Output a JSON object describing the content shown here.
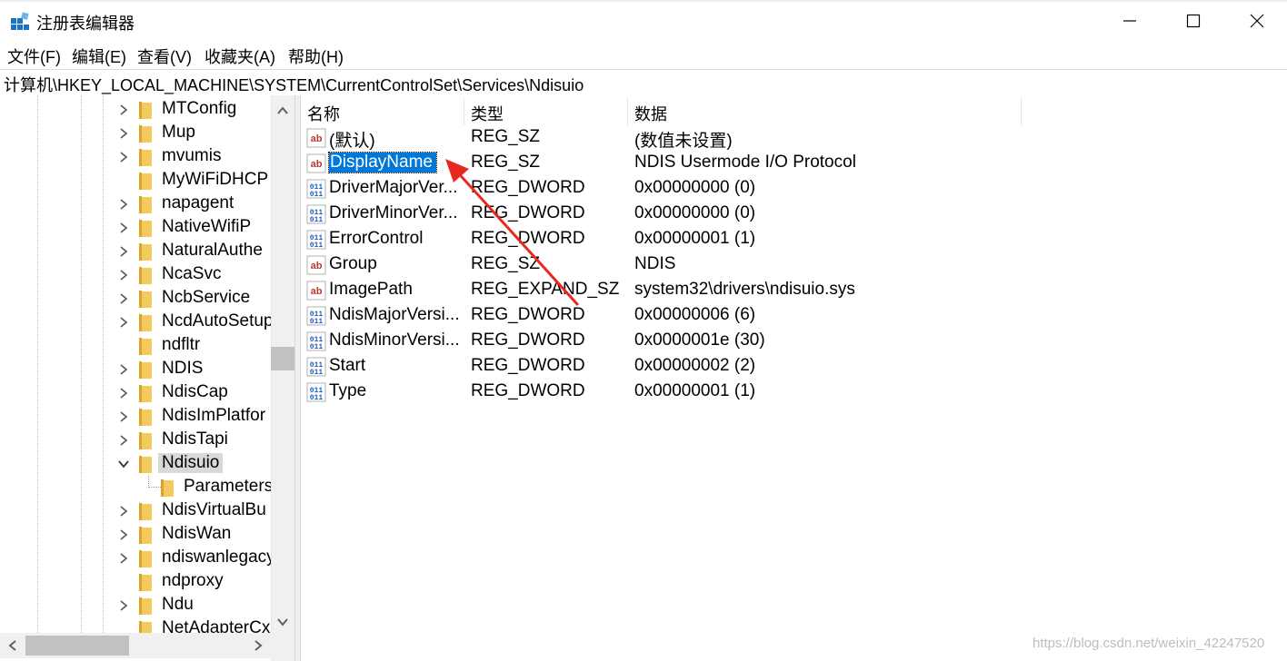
{
  "window": {
    "title": "注册表编辑器",
    "minimize_glyph": "—",
    "maximize_glyph": "☐",
    "close_glyph": "✕"
  },
  "menu": [
    {
      "label": "文件(F)"
    },
    {
      "label": "编辑(E)"
    },
    {
      "label": "查看(V)"
    },
    {
      "label": "收藏夹(A)"
    },
    {
      "label": "帮助(H)"
    }
  ],
  "address": "计算机\\HKEY_LOCAL_MACHINE\\SYSTEM\\CurrentControlSet\\Services\\Ndisuio",
  "tree": {
    "items": [
      {
        "label": "MTConfig",
        "expander": "collapsed"
      },
      {
        "label": "Mup",
        "expander": "collapsed"
      },
      {
        "label": "mvumis",
        "expander": "collapsed"
      },
      {
        "label": "MyWiFiDHCP",
        "expander": "none"
      },
      {
        "label": "napagent",
        "expander": "collapsed"
      },
      {
        "label": "NativeWifiP",
        "expander": "collapsed"
      },
      {
        "label": "NaturalAuthe",
        "expander": "collapsed"
      },
      {
        "label": "NcaSvc",
        "expander": "collapsed"
      },
      {
        "label": "NcbService",
        "expander": "collapsed"
      },
      {
        "label": "NcdAutoSetup",
        "expander": "collapsed"
      },
      {
        "label": "ndfltr",
        "expander": "none"
      },
      {
        "label": "NDIS",
        "expander": "collapsed"
      },
      {
        "label": "NdisCap",
        "expander": "collapsed"
      },
      {
        "label": "NdisImPlatfor",
        "expander": "collapsed"
      },
      {
        "label": "NdisTapi",
        "expander": "collapsed"
      },
      {
        "label": "Ndisuio",
        "expander": "expanded",
        "selected": true
      },
      {
        "label": "Parameters",
        "expander": "none",
        "child": true
      },
      {
        "label": "NdisVirtualBu",
        "expander": "collapsed"
      },
      {
        "label": "NdisWan",
        "expander": "collapsed"
      },
      {
        "label": "ndiswanlegacy",
        "expander": "collapsed"
      },
      {
        "label": "ndproxy",
        "expander": "none"
      },
      {
        "label": "Ndu",
        "expander": "collapsed"
      },
      {
        "label": "NetAdapterCx",
        "expander": "none"
      }
    ]
  },
  "columns": {
    "name": "名称",
    "type": "类型",
    "data": "数据"
  },
  "values": [
    {
      "name": "(默认)",
      "type": "REG_SZ",
      "data": "(数值未设置)",
      "icon": "string-value-icon"
    },
    {
      "name": "DisplayName",
      "type": "REG_SZ",
      "data": "NDIS Usermode I/O Protocol",
      "icon": "string-value-icon",
      "selected": true
    },
    {
      "name": "DriverMajorVer...",
      "type": "REG_DWORD",
      "data": "0x00000000 (0)",
      "icon": "binary-value-icon"
    },
    {
      "name": "DriverMinorVer...",
      "type": "REG_DWORD",
      "data": "0x00000000 (0)",
      "icon": "binary-value-icon"
    },
    {
      "name": "ErrorControl",
      "type": "REG_DWORD",
      "data": "0x00000001 (1)",
      "icon": "binary-value-icon"
    },
    {
      "name": "Group",
      "type": "REG_SZ",
      "data": "NDIS",
      "icon": "string-value-icon"
    },
    {
      "name": "ImagePath",
      "type": "REG_EXPAND_SZ",
      "data": "system32\\drivers\\ndisuio.sys",
      "icon": "string-value-icon"
    },
    {
      "name": "NdisMajorVersi...",
      "type": "REG_DWORD",
      "data": "0x00000006 (6)",
      "icon": "binary-value-icon"
    },
    {
      "name": "NdisMinorVersi...",
      "type": "REG_DWORD",
      "data": "0x0000001e (30)",
      "icon": "binary-value-icon"
    },
    {
      "name": "Start",
      "type": "REG_DWORD",
      "data": "0x00000002 (2)",
      "icon": "binary-value-icon"
    },
    {
      "name": "Type",
      "type": "REG_DWORD",
      "data": "0x00000001 (1)",
      "icon": "binary-value-icon"
    }
  ],
  "string_icon_text": "ab",
  "binary_icon_text": "011",
  "watermark": "https://blog.csdn.net/weixin_42247520",
  "colors": {
    "selection": "#0078d7",
    "annotation_arrow": "#e8281e",
    "folder": "#f4c95d"
  }
}
